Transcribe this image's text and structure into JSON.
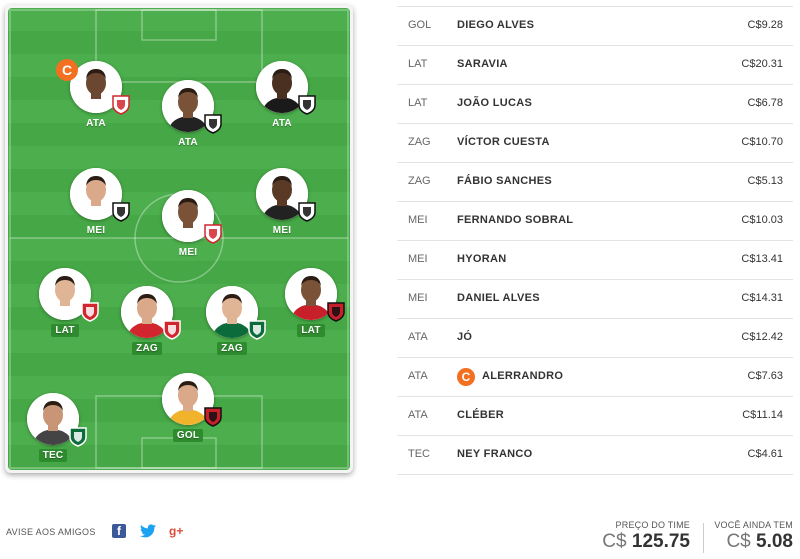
{
  "field": {
    "players": [
      {
        "pos": "ATA",
        "crest": "rb-bragantino",
        "captain": true,
        "skin": "#6b4630",
        "kit": "#ffffff"
      },
      {
        "pos": "ATA",
        "crest": "ceara",
        "captain": false,
        "skin": "#7a5238",
        "kit": "#222222"
      },
      {
        "pos": "ATA",
        "crest": "corinthians",
        "captain": false,
        "skin": "#4a3020",
        "kit": "#1a1a1a"
      },
      {
        "pos": "MEI",
        "crest": "atletico-mg",
        "captain": false,
        "skin": "#d9a98a",
        "kit": "#ffffff"
      },
      {
        "pos": "MEI",
        "crest": "sao-paulo",
        "captain": false,
        "skin": "#7a5238",
        "kit": "#ffffff"
      },
      {
        "pos": "MEI",
        "crest": "ceara",
        "captain": false,
        "skin": "#5a3a25",
        "kit": "#222222"
      },
      {
        "pos": "LAT",
        "crest": "internacional",
        "captain": false,
        "skin": "#e0b596",
        "kit": "#ffffff"
      },
      {
        "pos": "ZAG",
        "crest": "internacional",
        "captain": false,
        "skin": "#d9a98a",
        "kit": "#d2262e"
      },
      {
        "pos": "ZAG",
        "crest": "goias",
        "captain": false,
        "skin": "#e0b596",
        "kit": "#0b6b3a"
      },
      {
        "pos": "LAT",
        "crest": "flamengo",
        "captain": false,
        "skin": "#7a5238",
        "kit": "#c8202b"
      },
      {
        "pos": "GOL",
        "crest": "flamengo",
        "captain": false,
        "skin": "#d9a98a",
        "kit": "#f0b32b"
      },
      {
        "pos": "TEC",
        "crest": "goias",
        "captain": false,
        "skin": "#c99577",
        "kit": "#444444"
      }
    ],
    "captain_letter": "C"
  },
  "roster": [
    {
      "pos": "GOL",
      "name": "DIEGO ALVES",
      "price": "C$9.28",
      "captain": false
    },
    {
      "pos": "LAT",
      "name": "SARAVIA",
      "price": "C$20.31",
      "captain": false
    },
    {
      "pos": "LAT",
      "name": "JOÃO LUCAS",
      "price": "C$6.78",
      "captain": false
    },
    {
      "pos": "ZAG",
      "name": "VÍCTOR CUESTA",
      "price": "C$10.70",
      "captain": false
    },
    {
      "pos": "ZAG",
      "name": "FÁBIO SANCHES",
      "price": "C$5.13",
      "captain": false
    },
    {
      "pos": "MEI",
      "name": "FERNANDO SOBRAL",
      "price": "C$10.03",
      "captain": false
    },
    {
      "pos": "MEI",
      "name": "HYORAN",
      "price": "C$13.41",
      "captain": false
    },
    {
      "pos": "MEI",
      "name": "DANIEL ALVES",
      "price": "C$14.31",
      "captain": false
    },
    {
      "pos": "ATA",
      "name": "JÓ",
      "price": "C$12.42",
      "captain": false
    },
    {
      "pos": "ATA",
      "name": "ALERRANDRO",
      "price": "C$7.63",
      "captain": true
    },
    {
      "pos": "ATA",
      "name": "CLÉBER",
      "price": "C$11.14",
      "captain": false
    },
    {
      "pos": "TEC",
      "name": "NEY FRANCO",
      "price": "C$4.61",
      "captain": false
    }
  ],
  "footer": {
    "share_label": "AVISE AOS AMIGOS",
    "facebook_icon": "f",
    "twitter_icon": "🐦",
    "googleplus_icon": "g+",
    "team_price_label": "PREÇO DO TIME",
    "team_price_currency": "C$",
    "team_price_value": "125.75",
    "remaining_label": "VOCÊ AINDA TEM",
    "remaining_currency": "C$",
    "remaining_value": "5.08"
  },
  "colors": {
    "captain": "#f37021",
    "pitch_light": "#4cae4c",
    "pitch_dark": "#45a745",
    "crests": {
      "rb-bragantino": [
        "#ffffff",
        "#d2262e"
      ],
      "ceara": [
        "#ffffff",
        "#111111"
      ],
      "corinthians": [
        "#ffffff",
        "#111111"
      ],
      "atletico-mg": [
        "#ffffff",
        "#111111"
      ],
      "sao-paulo": [
        "#ffffff",
        "#d2262e"
      ],
      "internacional": [
        "#d2262e",
        "#ffffff"
      ],
      "goias": [
        "#0b6b3a",
        "#ffffff"
      ],
      "flamengo": [
        "#c8202b",
        "#111111"
      ]
    }
  }
}
